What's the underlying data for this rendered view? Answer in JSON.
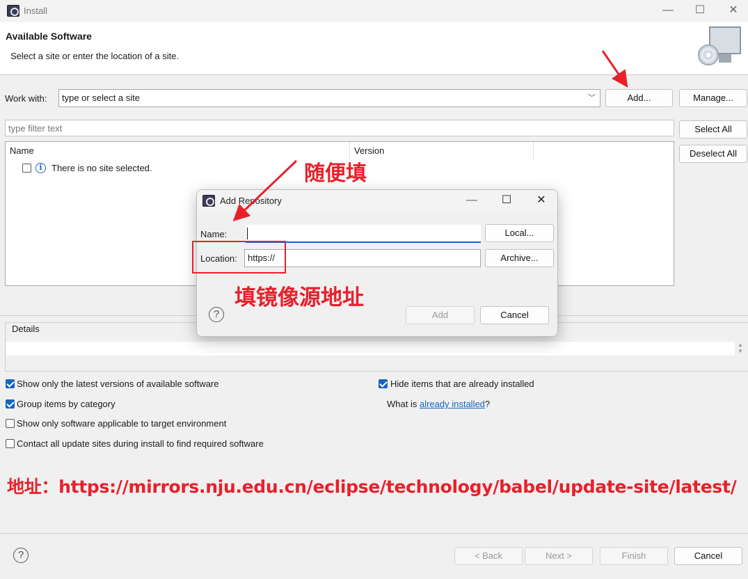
{
  "window": {
    "title": "Install"
  },
  "header": {
    "title": "Available Software",
    "subtitle": "Select a site or enter the location of a site."
  },
  "work_with": {
    "label": "Work with:",
    "value": "type or select a site",
    "add_label": "Add...",
    "manage_label": "Manage..."
  },
  "filter": {
    "placeholder": "type filter text",
    "select_all_label": "Select All",
    "deselect_all_label": "Deselect All"
  },
  "table": {
    "columns": [
      "Name",
      "Version"
    ],
    "rows": [
      {
        "name": "There is no site selected."
      }
    ]
  },
  "details": {
    "label": "Details"
  },
  "options": {
    "latest_versions": {
      "label": "Show only the latest versions of available software",
      "checked": true
    },
    "group_by_category": {
      "label": "Group items by category",
      "checked": true
    },
    "applicable_only": {
      "label": "Show only software applicable to target environment",
      "checked": false
    },
    "contact_all_sites": {
      "label": "Contact all update sites during install to find required software",
      "checked": false
    },
    "hide_installed": {
      "label": "Hide items that are already installed",
      "checked": true
    },
    "what_is_prefix": "What is ",
    "what_is_link": "already installed",
    "what_is_suffix": "?"
  },
  "footer": {
    "back_label": "< Back",
    "next_label": "Next >",
    "finish_label": "Finish",
    "cancel_label": "Cancel"
  },
  "dialog": {
    "title": "Add Repository",
    "name_label": "Name:",
    "name_value": "",
    "location_label": "Location:",
    "location_value": "https://",
    "local_label": "Local...",
    "archive_label": "Archive...",
    "add_label": "Add",
    "cancel_label": "Cancel"
  },
  "annotations": {
    "fill_anything": "随便填",
    "fill_mirror": "填镜像源地址",
    "address_line": "地址：https://mirrors.nju.edu.cn/eclipse/technology/babel/update-site/latest/"
  },
  "colors": {
    "accent": "#1565c0",
    "annotation_red": "#e8202a"
  }
}
